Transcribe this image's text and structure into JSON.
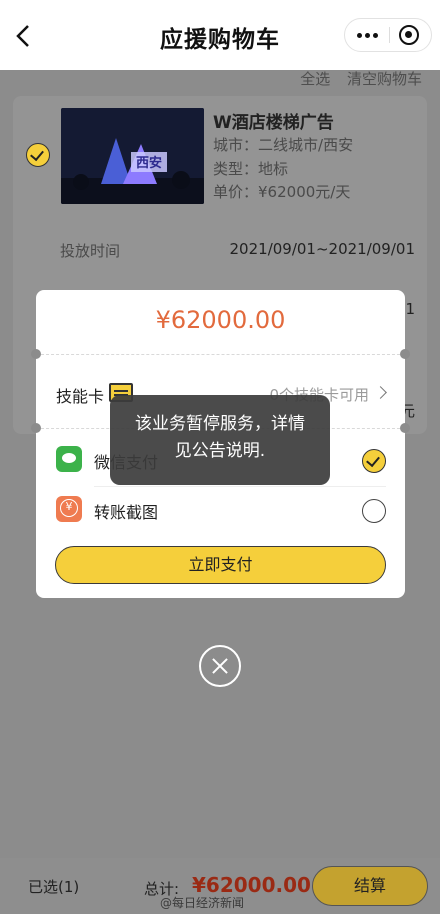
{
  "header": {
    "title": "应援购物车"
  },
  "toolbar": {
    "select_all": "全选",
    "clear_cart": "清空购物车"
  },
  "cart_item": {
    "name": "W酒店楼梯广告",
    "city_label": "城市：",
    "city": "二线城市/西安",
    "type_label": "类型：",
    "type": "地标",
    "price_label": "单价：",
    "price": "¥62000元/天",
    "thumb_text": "西安",
    "period_label": "投放时间",
    "period_value": "2021/09/01~2021/09/01",
    "peek_count": "1",
    "peek_unit": "元"
  },
  "modal": {
    "amount": "¥62000.00",
    "skill_card_label": "技能卡",
    "skill_card_available": "0个技能卡可用",
    "wechat_pay_label": "微信支付",
    "transfer_label": "转账截图",
    "pay_button": "立即支付"
  },
  "toast": {
    "message": "该业务暂停服务，详情见公告说明."
  },
  "footer": {
    "selected": "已选(1)",
    "total_label": "总计:",
    "total_amount": "¥62000.00",
    "checkout_button": "结算",
    "watermark": "@每日经济新闻"
  },
  "colors": {
    "accent_yellow": "#f5cf3b",
    "price_orange": "#e26a3d",
    "overlay": "#8c8c8c",
    "wechat_green": "#3cb24a"
  }
}
